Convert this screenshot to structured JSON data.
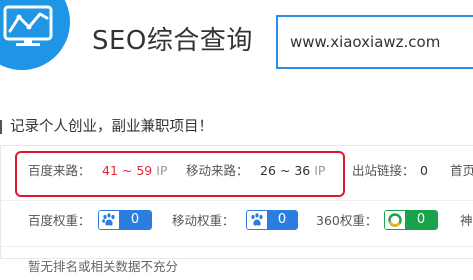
{
  "header": {
    "title": "SEO综合查询",
    "logo_icon": "monitor-chart-icon",
    "brand_color": "#1f95e6",
    "search": {
      "value": "www.xiaoxiawz.com",
      "border_color": "#2d8ee8"
    }
  },
  "slogan": "记录个人创业，副业兼职项目！",
  "traffic": {
    "baidu_label": "百度来路：",
    "baidu_value": "41 ~ 59",
    "baidu_unit": "IP",
    "mobile_label": "移动来路：",
    "mobile_value": "26 ~ 36",
    "mobile_unit": "IP",
    "outlinks_label": "出站链接：",
    "outlinks_value": "0",
    "home_label": "首页",
    "highlight_color": "#e0182d"
  },
  "weights": {
    "baidu_label": "百度权重：",
    "baidu_value": "0",
    "baidu_icon": "baidu-paw-icon",
    "mobile_label": "移动权重：",
    "mobile_value": "0",
    "mobile_icon": "baidu-mobile-paw-icon",
    "s360_label": "360权重：",
    "s360_value": "0",
    "s360_icon": "360-logo-icon",
    "next_label": "神"
  },
  "note": "暂无排名或相关数据不充分"
}
